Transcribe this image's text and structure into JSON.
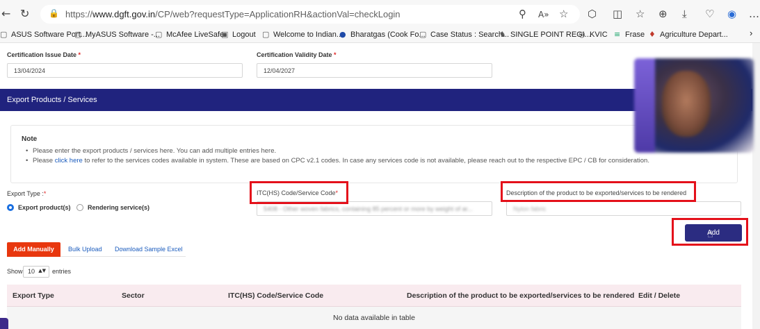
{
  "browser": {
    "url_prefix": "https://",
    "url_domain": "www.dgft.gov.in",
    "url_path": "/CP/web?requestType=ApplicationRH&actionVal=checkLogin",
    "icons": {
      "back": "back-arrow-icon",
      "refresh": "refresh-icon",
      "lock": "lock-icon",
      "zoom": "zoom-icon",
      "read_aloud": "read-aloud-icon",
      "favorite": "star-icon",
      "extensions": "extensions-icon",
      "split": "split-screen-icon",
      "favorites_list": "favorites-list-icon",
      "collections": "collections-icon",
      "downloads": "download-icon",
      "browser_essentials": "heart-icon",
      "copilot": "copilot-icon",
      "more": "more-icon"
    },
    "glyphs": {
      "back": "←",
      "refresh": "↻",
      "lock": "🔒",
      "zoom": "⚲",
      "read_aloud": "A»",
      "favorite": "☆",
      "extensions": "⬡",
      "split": "◫",
      "favorites_list": "☆",
      "collections": "⊕",
      "downloads": "⤓",
      "browser_essentials": "♡",
      "copilot": "◉",
      "more": "…",
      "bm_chevron": "›"
    }
  },
  "bookmarks": [
    {
      "label": "ASUS Software Port...",
      "icon": "▢"
    },
    {
      "label": "MyASUS Software -...",
      "icon": "▢"
    },
    {
      "label": "McAfee LiveSafe",
      "icon": "▢"
    },
    {
      "label": "Logout",
      "icon": "▣"
    },
    {
      "label": "Welcome to Indian...",
      "icon": "▢"
    },
    {
      "label": "Bharatgas (Cook Fo...",
      "icon": "●"
    },
    {
      "label": "Case Status : Search...",
      "icon": "▢"
    },
    {
      "label": "SINGLE POINT REGI...",
      "icon": "♞"
    },
    {
      "label": "KVIC",
      "icon": "◎"
    },
    {
      "label": "Frase",
      "icon": "≡"
    },
    {
      "label": "Agriculture Depart...",
      "icon": "♦"
    }
  ],
  "certificates": {
    "issue_label": "Certification Issue Date",
    "issue_value": "13/04/2024",
    "validity_label": "Certification Validity Date",
    "validity_value": "12/04/2027",
    "required_mark": "*"
  },
  "section": {
    "title": "Export Products / Services"
  },
  "note": {
    "title": "Note",
    "line1": "Please enter the export products / services here. You can add multiple entries here.",
    "line2_prefix": "Please ",
    "line2_link": "click here",
    "line2_suffix": " to refer to the services codes available in system. These are based on CPC v2.1 codes. In case any services code is not available, please reach out to the respective EPC / CB for consideration."
  },
  "form": {
    "export_type_label": "Export Type :",
    "export_type_required": "*",
    "option_product": "Export product(s)",
    "option_service": "Rendering service(s)",
    "selected_option": "Export product(s)",
    "itc_label": "ITC(HS) Code/Service Code",
    "itc_required": "*",
    "itc_value": "5408 - Other woven fabrics, containing 85 percent or more by weight of ar...",
    "description_label": "Description of the product to be exported/services to be rendered",
    "description_value": "Nylon fabric",
    "add_button": "Add"
  },
  "tabs": [
    {
      "label": "Add Manually",
      "active": true
    },
    {
      "label": "Bulk Upload",
      "active": false
    },
    {
      "label": "Download Sample Excel",
      "active": false
    }
  ],
  "pagination": {
    "show_label": "Show",
    "entries_value": "10",
    "entries_label": "entries",
    "arrow": "▲▼"
  },
  "table": {
    "columns": [
      "Export Type",
      "Sector",
      "ITC(HS) Code/Service Code",
      "Description of the product to be exported/services to be rendered",
      "Edit / Delete"
    ],
    "empty_message": "No data available in table"
  },
  "colors": {
    "accent": "#20237e",
    "required": "#e02424",
    "highlight": "#e4101a",
    "active_tab": "#e8370e"
  }
}
